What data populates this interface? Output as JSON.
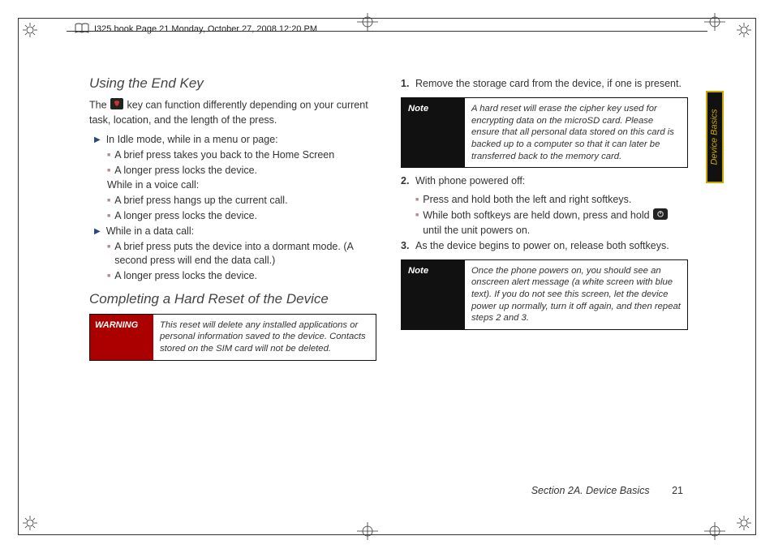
{
  "header": {
    "text": "I325.book  Page 21  Monday, October 27, 2008  12:20 PM"
  },
  "sideTab": "Device Basics",
  "footer": {
    "section": "Section 2A. Device Basics",
    "page": "21"
  },
  "left": {
    "h1": "Using the End Key",
    "p1a": "The ",
    "p1b": " key can function differently depending on your current task, location, and the length of the press.",
    "b1": "In Idle mode, while in a menu or page:",
    "b1a": "A brief press takes you back to the Home Screen",
    "b1b": "A longer press locks the device.",
    "mid": "While in a voice call:",
    "b1c": "A brief press hangs up the current call.",
    "b1d": "A longer press locks the device.",
    "b2": "While in a data call:",
    "b2a": "A brief press puts the device into a dormant mode. (A second press will end the data call.)",
    "b2b": "A longer press locks the device.",
    "h2": "Completing a Hard Reset of the Device",
    "warnLabel": "WARNING",
    "warnBody": "This reset will delete any installed applications or personal information saved to the device. Contacts stored on the SIM card will not be deleted."
  },
  "right": {
    "s1n": "1.",
    "s1": "Remove the storage card from the device, if one is present.",
    "note1Label": "Note",
    "note1": "A hard reset will erase the cipher key used for encrypting data on the microSD card. Please ensure that all personal data stored on this card is backed up to a computer so that it can later be transferred back to the memory card.",
    "s2n": "2.",
    "s2": "With phone powered off:",
    "s2a": "Press and hold both the left and right softkeys.",
    "s2bA": "While both softkeys are held down, press and hold ",
    "s2bB": " until the unit powers on.",
    "s3n": "3.",
    "s3": "As the device begins to power on, release both softkeys.",
    "note2Label": "Note",
    "note2": "Once the phone powers on, you should see an onscreen alert message (a white screen with blue text). If you do not see this screen, let the device power up normally, turn it off again, and then repeat steps 2 and 3."
  }
}
